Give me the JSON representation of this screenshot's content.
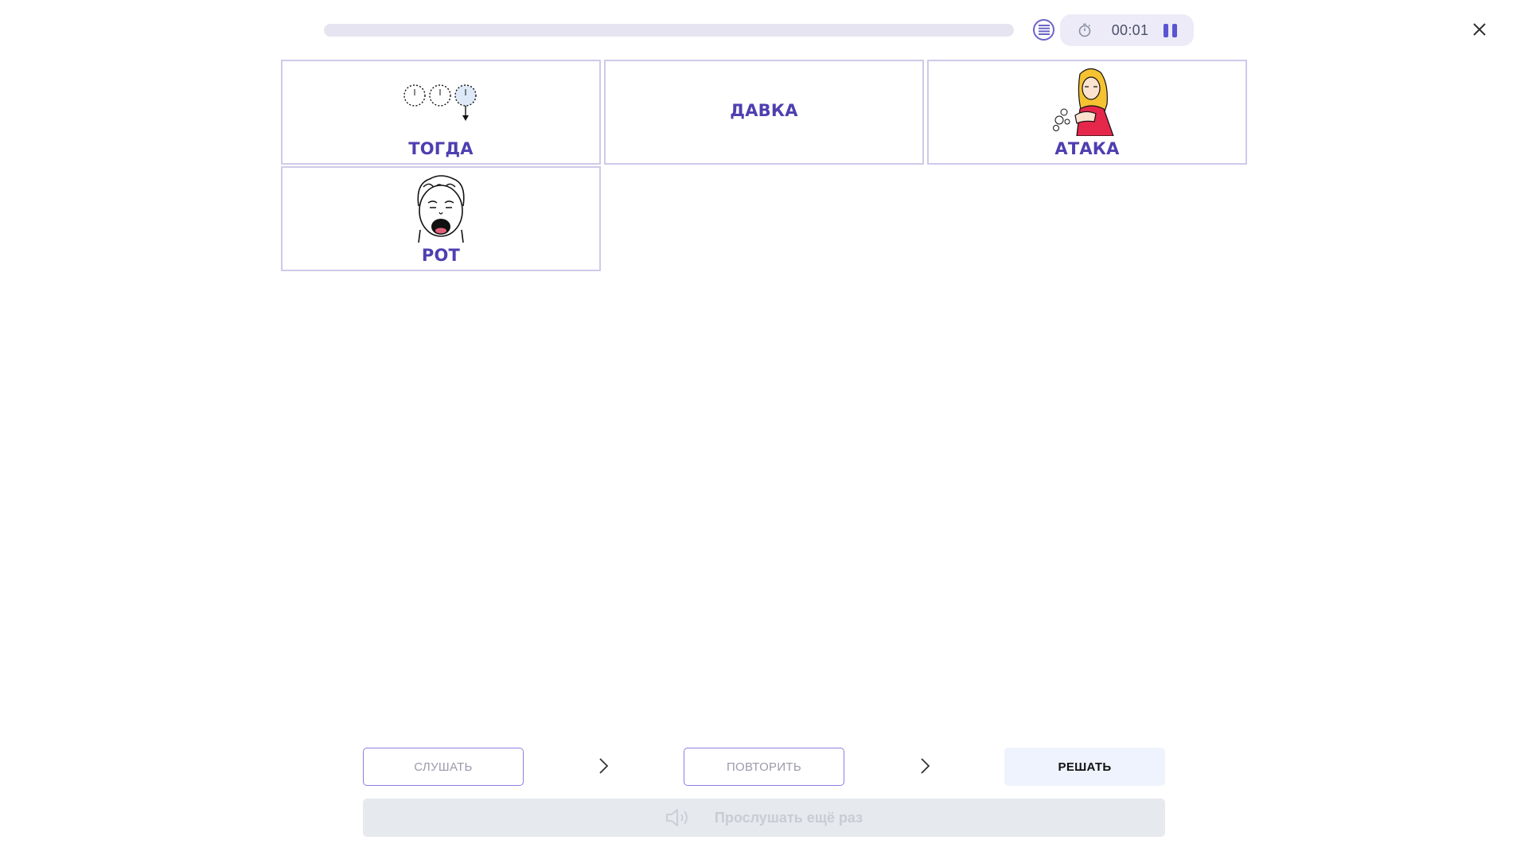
{
  "header": {
    "progress_percent": 0,
    "timer": "00:01"
  },
  "cards": [
    {
      "label": "ТОГДА",
      "icon": "clocks-sequence-icon"
    },
    {
      "label": "ДАВКА",
      "icon": null
    },
    {
      "label": "АТАКА",
      "icon": "girl-coughing-icon"
    },
    {
      "label": "РОТ",
      "icon": "boy-open-mouth-icon"
    }
  ],
  "steps": {
    "listen": "СЛУШАТЬ",
    "repeat": "ПОВТОРИТЬ",
    "solve": "РЕШАТЬ"
  },
  "replay": {
    "label": "Прослушать ещё раз"
  },
  "colors": {
    "accent": "#4e3fb0",
    "card_border": "#cfcaea",
    "step_border": "#8a7fe0",
    "active_step_bg": "#eef3fd",
    "replay_bg": "#e6e9ee"
  }
}
